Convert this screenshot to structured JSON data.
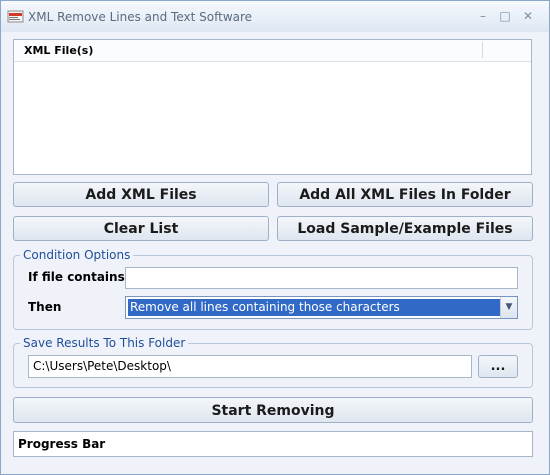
{
  "window": {
    "title": "XML Remove Lines and Text Software"
  },
  "controls": {
    "minimize": "–",
    "maximize": "□",
    "close": "✕"
  },
  "file_list": {
    "column_header": "XML File(s)",
    "items": []
  },
  "buttons": {
    "add_xml_files": "Add XML Files",
    "add_all_folder": "Add All XML Files In Folder",
    "clear_list": "Clear List",
    "load_sample": "Load Sample/Example Files",
    "start_removing": "Start Removing",
    "browse": "..."
  },
  "condition_options": {
    "legend": "Condition Options",
    "if_file_contains_label": "If file contains",
    "if_file_contains_value": "",
    "then_label": "Then",
    "then_selected": "Remove all lines containing those characters"
  },
  "save_results": {
    "legend": "Save Results To This Folder",
    "folder_path": "C:\\Users\\Pete\\Desktop\\"
  },
  "progress_bar": {
    "label": "Progress Bar",
    "value": 0
  },
  "colors": {
    "window_bg": "#eff3f9",
    "legend_blue": "#1f4e9c",
    "selection_blue": "#3169c6"
  },
  "icons": {
    "app": "xml-document-icon",
    "dropdown": "chevron-down-icon"
  }
}
